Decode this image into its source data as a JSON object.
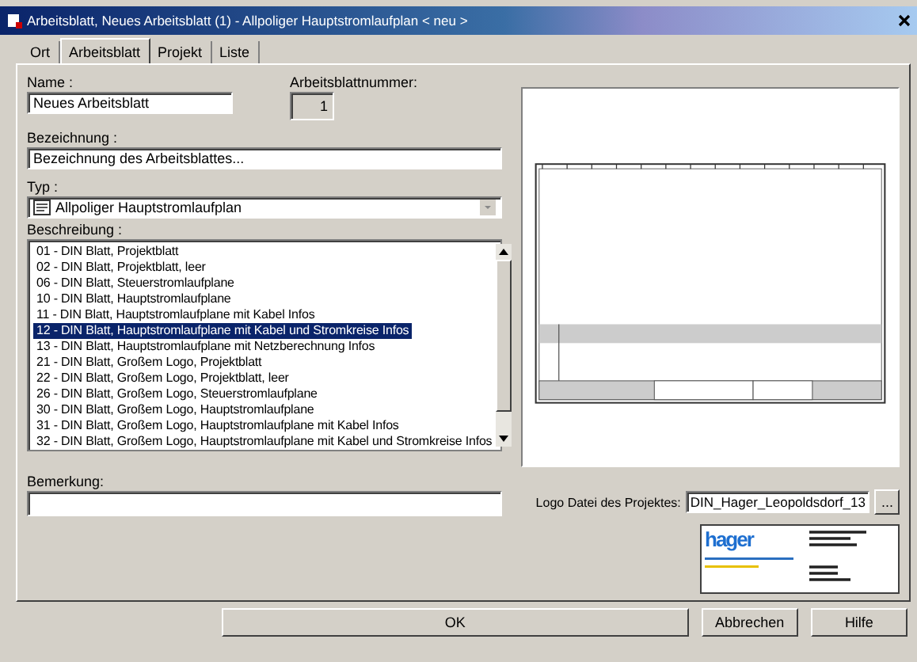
{
  "window": {
    "title": "Arbeitsblatt, Neues Arbeitsblatt (1) - Allpoliger Hauptstromlaufplan < neu >"
  },
  "tabs": [
    {
      "label": "Ort",
      "selected": false
    },
    {
      "label": "Arbeitsblatt",
      "selected": true
    },
    {
      "label": "Projekt",
      "selected": false
    },
    {
      "label": "Liste",
      "selected": false
    }
  ],
  "name": {
    "label": "Name :",
    "value": "Neues Arbeitsblatt"
  },
  "sheet_number": {
    "label": "Arbeitsblattnummer:",
    "value": "1",
    "disabled": true
  },
  "designation": {
    "label": "Bezeichnung :",
    "value": "Bezeichnung des Arbeitsblattes..."
  },
  "type": {
    "label": "Typ :",
    "value": "Allpoliger Hauptstromlaufplan"
  },
  "description": {
    "label": "Beschreibung :",
    "items": [
      {
        "text": "01 - DIN Blatt, Projektblatt",
        "selected": false
      },
      {
        "text": "02 - DIN Blatt, Projektblatt, leer",
        "selected": false
      },
      {
        "text": "06 - DIN Blatt, Steuerstromlaufplane",
        "selected": false
      },
      {
        "text": "10 - DIN Blatt, Hauptstromlaufplane",
        "selected": false
      },
      {
        "text": "11 - DIN Blatt, Hauptstromlaufplane mit Kabel Infos",
        "selected": false
      },
      {
        "text": "12 - DIN Blatt, Hauptstromlaufplane mit Kabel und Stromkreise Infos",
        "selected": true
      },
      {
        "text": "13 - DIN Blatt, Hauptstromlaufplane mit Netzberechnung Infos",
        "selected": false
      },
      {
        "text": "21 - DIN Blatt, Großem Logo, Projektblatt",
        "selected": false
      },
      {
        "text": "22 - DIN Blatt, Großem Logo, Projektblatt, leer",
        "selected": false
      },
      {
        "text": "26 - DIN Blatt, Großem Logo, Steuerstromlaufplane",
        "selected": false
      },
      {
        "text": "30 - DIN Blatt, Großem Logo, Hauptstromlaufplane",
        "selected": false
      },
      {
        "text": "31 - DIN Blatt, Großem Logo, Hauptstromlaufplane mit Kabel Infos",
        "selected": false
      },
      {
        "text": "32 - DIN Blatt, Großem Logo, Hauptstromlaufplane mit Kabel und Stromkreise Infos",
        "selected": false
      }
    ]
  },
  "remark": {
    "label": "Bemerkung:"
  },
  "logo": {
    "label": "Logo Datei des Projektes:",
    "value": "DIN_Hager_Leopoldsdorf_13",
    "browse": "...",
    "logo_text": "hager"
  },
  "buttons": [
    "OK",
    "Abbrechen",
    "Hilfe"
  ]
}
